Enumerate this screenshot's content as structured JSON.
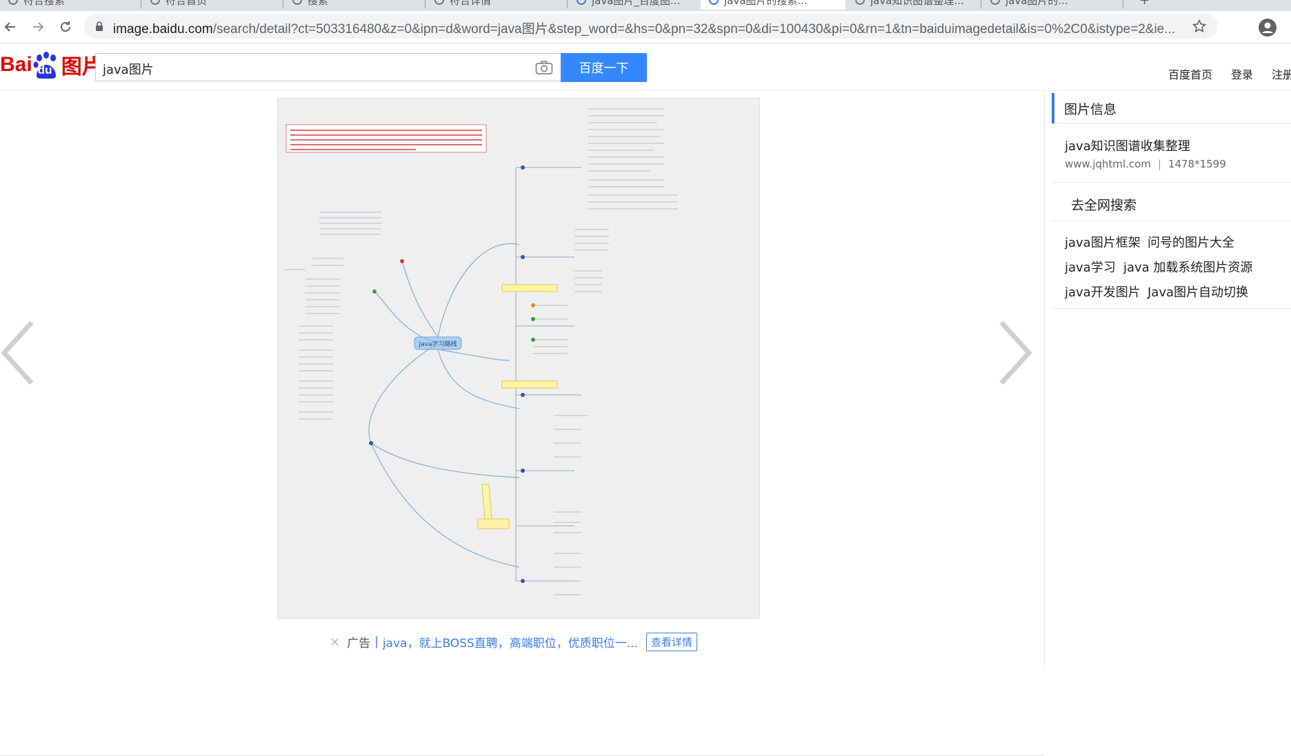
{
  "browser": {
    "tabs": [
      {
        "label": "符合搜索"
      },
      {
        "label": "符合首页"
      },
      {
        "label": "搜索"
      },
      {
        "label": "符合详情"
      },
      {
        "label": "java图片_百度图..."
      },
      {
        "label": "java图片的搜索..."
      },
      {
        "label": "java知识图谱整理..."
      },
      {
        "label": "java图片的..."
      }
    ],
    "url_host": "image.baidu.com",
    "url_rest": "/search/detail?ct=503316480&z=0&ipn=d&word=java图片&step_word=&hs=0&pn=32&spn=0&di=100430&pi=0&rn=1&tn=baiduimagedetail&is=0%2C0&istype=2&ie...",
    "icons": {
      "back": "back-arrow-icon",
      "forward": "forward-arrow-icon",
      "reload": "reload-icon",
      "lock": "lock-icon",
      "bookmark": "star-icon",
      "profile": "profile-icon"
    }
  },
  "header": {
    "logo_left": "Bai",
    "logo_mid": "du",
    "logo_right": "图片",
    "search_value": "java图片",
    "search_button": "百度一下",
    "links": [
      "百度首页",
      "登录",
      "注册"
    ],
    "brand_color": "#3388ff",
    "logo_color": "#e10602"
  },
  "viewer": {
    "image_alt": "Java学习路线",
    "image_center_label": "Java学习路线",
    "ad": {
      "close": "×",
      "tag": "广告",
      "text": "java，就上BOSS直聘，高端职位，优质职位一...",
      "detail_button": "查看详情"
    }
  },
  "sidebar": {
    "info_heading": "图片信息",
    "image_title": "java知识图谱收集整理",
    "image_source": "www.jqhtml.com",
    "image_size": "1478*1599",
    "search_heading": "去全网搜索",
    "related": [
      "java图片框架",
      "问号的图片大全",
      "java学习",
      "java 加载系统图片资源",
      "java开发图片",
      "Java图片自动切换"
    ],
    "accent_color": "#3b7de9"
  }
}
